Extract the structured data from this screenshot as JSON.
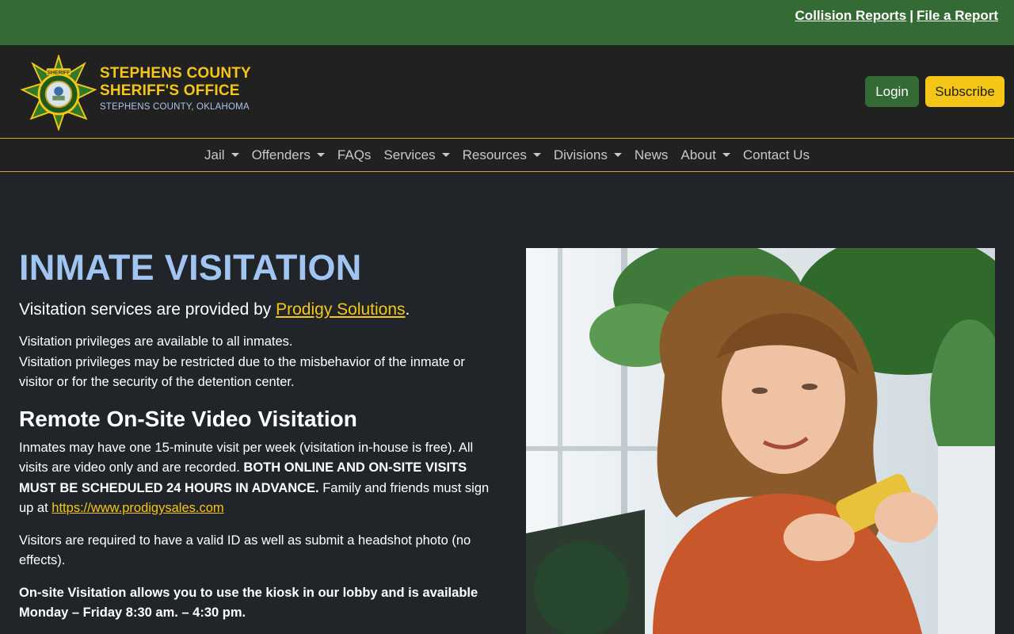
{
  "topbar": {
    "collision_reports": "Collision Reports",
    "separator": "|",
    "file_report": "File a Report"
  },
  "header": {
    "logo_text": "SHERIFF",
    "brand_line1": "STEPHENS COUNTY",
    "brand_line2": "SHERIFF'S OFFICE",
    "brand_line3": "STEPHENS COUNTY, OKLAHOMA",
    "login": "Login",
    "subscribe": "Subscribe"
  },
  "nav": {
    "jail": "Jail",
    "offenders": "Offenders",
    "faqs": "FAQs",
    "services": "Services",
    "resources": "Resources",
    "divisions": "Divisions",
    "news": "News",
    "about": "About",
    "contact": "Contact Us"
  },
  "main": {
    "title": "INMATE VISITATION",
    "lead_text": "Visitation services are provided by ",
    "lead_link": "Prodigy Solutions",
    "lead_end": ".",
    "p1_line1": "Visitation privileges are available to all inmates.",
    "p1_line2": "Visitation privileges may be restricted due to the misbehavior of the inmate or visitor or for the security of the detention center.",
    "h2": "Remote On-Site Video Visitation",
    "p2_text1": "Inmates may have one 15-minute visit per week (visitation in-house is free). All visits are video only and are recorded. ",
    "p2_bold": "BOTH ONLINE AND ON-SITE VISITS MUST BE SCHEDULED 24 HOURS IN ADVANCE.",
    "p2_text2": " Family and friends must sign up at ",
    "p2_link": "https://www.prodigysales.com",
    "p3": "Visitors are required to have a valid ID as well as submit a headshot photo (no effects).",
    "p4_line1": "On-site Visitation allows you to use the kiosk in our lobby and is available",
    "p4_line2": "Monday – Friday 8:30 am. – 4:30 pm."
  },
  "colors": {
    "green": "#346a33",
    "gold": "#f5c518",
    "title_blue": "#9fc5f0",
    "dark_bg": "#212529"
  }
}
